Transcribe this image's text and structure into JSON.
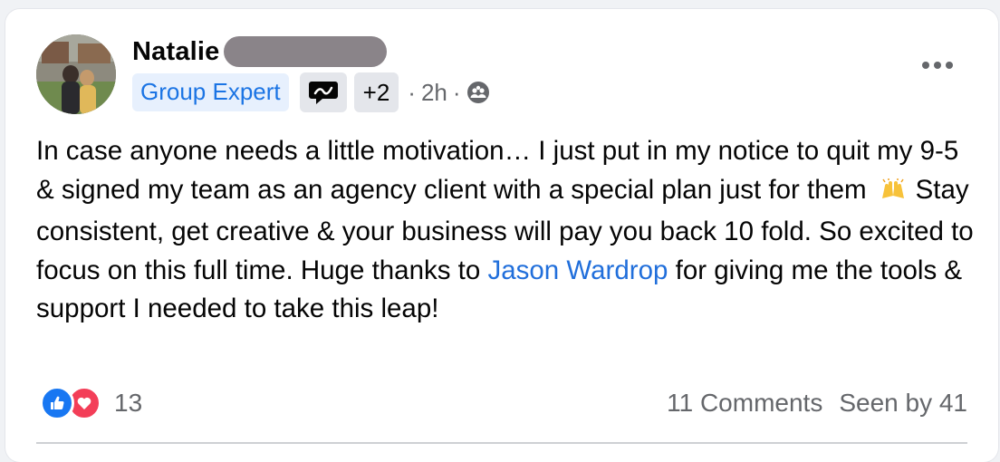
{
  "post": {
    "author_name": "Natalie",
    "badges": {
      "expert_label": "Group Expert",
      "more_count": "+2"
    },
    "time": "2h",
    "visibility_icon": "group-icon",
    "text_parts": {
      "part1": "In case anyone needs a little motivation… I just put in my notice to quit my 9-5 & signed my team as an agency client with a special plan just for them",
      "emoji": "🙌",
      "part2": "Stay consistent, get creative & your business will pay you back 10 fold. So excited to focus on this full time. Huge thanks to",
      "mention": "Jason Wardrop",
      "part3": "for giving me the tools & support I needed to take this leap!"
    },
    "reactions": {
      "count": "13",
      "types": [
        "like",
        "love"
      ]
    },
    "comments_label": "11 Comments",
    "seen_label": "Seen by 41"
  },
  "colors": {
    "expert_bg": "#e7f0fd",
    "expert_text": "#1b74e4",
    "mention": "#216fdb",
    "like": "#1877f2",
    "love": "#f33e58"
  }
}
